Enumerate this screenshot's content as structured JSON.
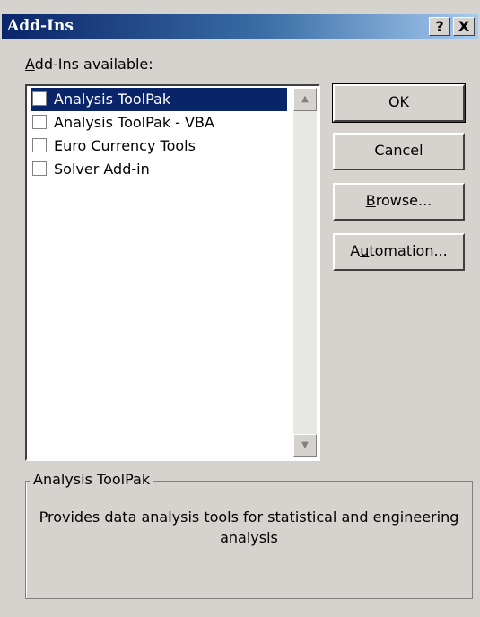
{
  "window": {
    "title": "Add-Ins",
    "help_label": "?",
    "close_label": "X"
  },
  "available": {
    "label_prefix": "A",
    "label_rest": "dd-Ins available:",
    "items": [
      {
        "label": "Analysis ToolPak",
        "checked": false,
        "selected": true
      },
      {
        "label": "Analysis ToolPak - VBA",
        "checked": false,
        "selected": false
      },
      {
        "label": "Euro Currency Tools",
        "checked": false,
        "selected": false
      },
      {
        "label": "Solver Add-in",
        "checked": false,
        "selected": false
      }
    ],
    "scroll_up_icon": "▲",
    "scroll_down_icon": "▼"
  },
  "buttons": {
    "ok": "OK",
    "cancel": "Cancel",
    "browse_mnemonic": "B",
    "browse_rest": "rowse...",
    "automation_pre": "A",
    "automation_mnemonic": "u",
    "automation_rest": "tomation..."
  },
  "description": {
    "title": "Analysis ToolPak",
    "text": "Provides data analysis tools for statistical and engineering analysis"
  },
  "colors": {
    "face": "#d6d3ce",
    "selection": "#0a246a",
    "title_start": "#0a246a",
    "title_end": "#a6caf0"
  }
}
